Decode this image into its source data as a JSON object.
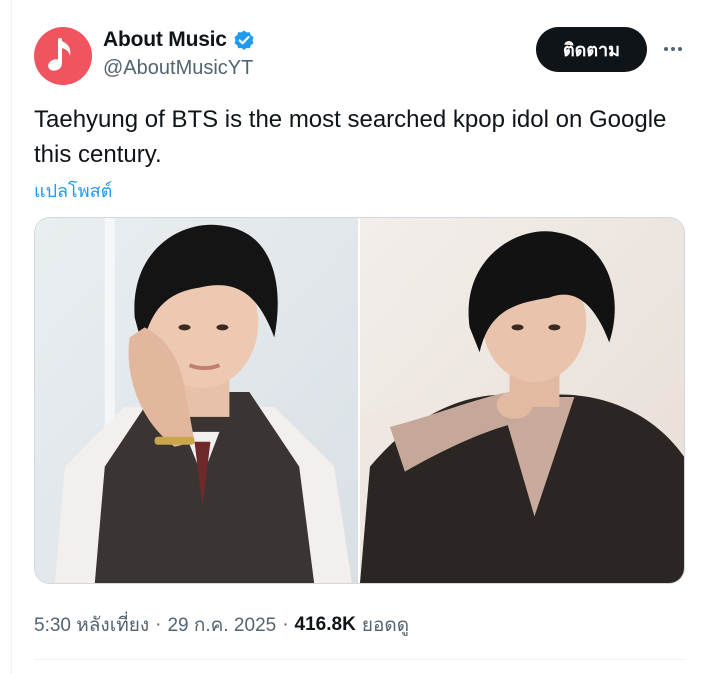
{
  "author": {
    "display_name": "About Music",
    "handle": "@AboutMusicYT",
    "avatar_icon": "music-note-icon",
    "avatar_color": "#f0545f",
    "verified": true,
    "verified_color": "#1d9bf0"
  },
  "actions": {
    "follow_label": "ติดตาม",
    "more_icon": "more-horizontal-icon"
  },
  "tweet": {
    "text": "Taehyung of BTS is the most searched kpop idol on Google this century.",
    "translate_label": "แปลโพสต์"
  },
  "media": {
    "photos": 2
  },
  "meta": {
    "time": "5:30 หลังเที่ยง",
    "separator": "·",
    "date": "29 ก.ค. 2025",
    "views": "416.8K",
    "views_label": "ยอดดู"
  },
  "colors": {
    "text_primary": "#0f1419",
    "text_secondary": "#536471",
    "link": "#1d9bf0",
    "button_bg": "#0f1419",
    "border": "#cfd9de"
  }
}
